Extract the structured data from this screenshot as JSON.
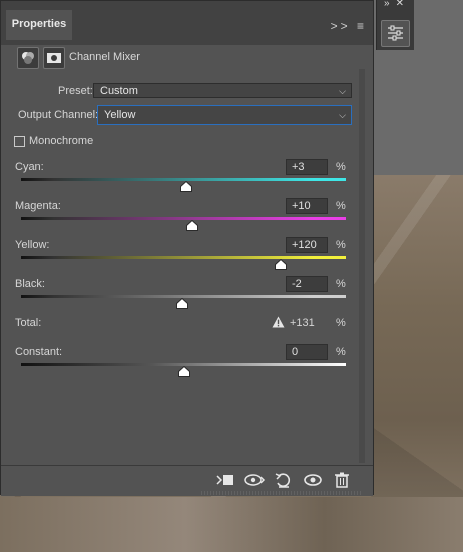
{
  "panel": {
    "tab_label": "Properties",
    "menu_expand_icon": "double-chevron-right-icon",
    "menu_icon": "hamburger-menu-icon",
    "adjustment_title": "Channel Mixer"
  },
  "top_right": {
    "collapse_icon": "double-chevron-right-icon",
    "close_icon": "close-icon",
    "adjustments_icon": "sliders-icon"
  },
  "preset": {
    "label": "Preset:",
    "value": "Custom"
  },
  "output_channel": {
    "label": "Output Channel:",
    "value": "Yellow"
  },
  "monochrome": {
    "label": "Monochrome",
    "checked": false
  },
  "sliders": [
    {
      "label": "Cyan:",
      "value": "+3",
      "unit": "%",
      "fraction": 0.507,
      "color": "#3fe6e6"
    },
    {
      "label": "Magenta:",
      "value": "+10",
      "unit": "%",
      "fraction": 0.525,
      "color": "#e93fe6"
    },
    {
      "label": "Yellow:",
      "value": "+120",
      "unit": "%",
      "fraction": 0.8,
      "color": "#f2f03c"
    },
    {
      "label": "Black:",
      "value": "-2",
      "unit": "%",
      "fraction": 0.495,
      "color": "#cfcfcf"
    }
  ],
  "total": {
    "label": "Total:",
    "value": "+131",
    "unit": "%",
    "warning_icon": "warning-triangle-icon"
  },
  "constant": {
    "label": "Constant:",
    "value": "0",
    "unit": "%",
    "fraction": 0.5
  },
  "footer": {
    "icons": [
      "clip-to-layer-icon",
      "view-previous-state-icon",
      "reset-icon",
      "visibility-eye-icon",
      "trash-icon"
    ]
  }
}
